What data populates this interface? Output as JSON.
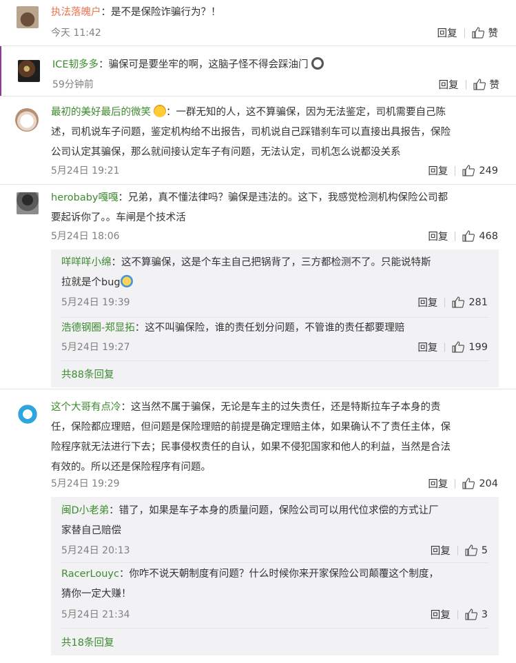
{
  "comments": [
    {
      "nick": "执法落魄户",
      "text": "：是不是保险诈骗行为？！",
      "time": "今天 11:42",
      "reply_label": "回复",
      "like_label": "赞"
    },
    {
      "nick": "ICE韧多多",
      "text": "：骗保可是要坐牢的啊，这脑子怪不得会踩油门",
      "time": "59分钟前",
      "reply_label": "回复",
      "like_label": "赞"
    },
    {
      "nick": "最初的美好最后的微笑",
      "line1": "：一群无知的人，这不算骗保，因为无法鉴定，司机需要自己陈",
      "line2": "述，司机说车子问题，鉴定机构给不出报告，司机说自己踩错刹车可以直接出具报告，保险",
      "line3": "公司认定其骗保，那么就间接认定车子有问题，无法认定，司机怎么说都没关系",
      "time": "5月24日 19:21",
      "reply_label": "回复",
      "likes": "249"
    },
    {
      "nick": "herobaby嘎嘎",
      "line1": "：兄弟，真不懂法律吗？骗保是违法的。这下，我感觉检测机构保险公司都",
      "line2": "要起诉你了。。车闸是个技术活",
      "time": "5月24日 18:06",
      "reply_label": "回复",
      "likes": "468",
      "replies": [
        {
          "nick": "咩咩咩小绵",
          "line1": "：这不算骗保，这是个车主自己把锅背了，三方都检测不了。只能说特斯",
          "line2": "拉就是个bug",
          "time": "5月24日 19:39",
          "reply_label": "回复",
          "likes": "281"
        },
        {
          "nick": "浩德钢圈-郑显拓",
          "line1": "：这不叫骗保险，谁的责任划分问题，不管谁的责任都要理赔",
          "time": "5月24日 19:27",
          "reply_label": "回复",
          "likes": "199"
        }
      ],
      "more": "共88条回复"
    },
    {
      "nick": "这个大哥有点冷",
      "line1": "：这当然不属于骗保，无论是车主的过失责任，还是特斯拉车子本身的责",
      "line2": "任，保险都应理赔，但问题是保险理赔的前提是确定理赔主体，如果确认不了责任主体，保",
      "line3": "险程序就无法进行下去；民事侵权责任的自认，如果不侵犯国家和他人的利益，当然是合法",
      "line4": "有效的。所以还是保险程序有问题。",
      "time": "5月24日 19:29",
      "reply_label": "回复",
      "likes": "204",
      "replies": [
        {
          "nick": "闽D小老弟",
          "line1": "：错了，如果是车子本身的质量问题，保险公司可以用代位求偿的方式让厂",
          "line2": "家替自己赔偿",
          "time": "5月24日 20:13",
          "reply_label": "回复",
          "likes": "5"
        },
        {
          "nick": "RacerLouyc",
          "line1": "：你咋不说天朝制度有问题？什么时候你来开家保险公司颠覆这个制度，",
          "line2": "猜你一定大赚！",
          "time": "5月24日 21:34",
          "reply_label": "回复",
          "likes": "3"
        }
      ],
      "more": "共18条回复"
    }
  ],
  "icons": {
    "like": "thumbs-up-icon"
  }
}
